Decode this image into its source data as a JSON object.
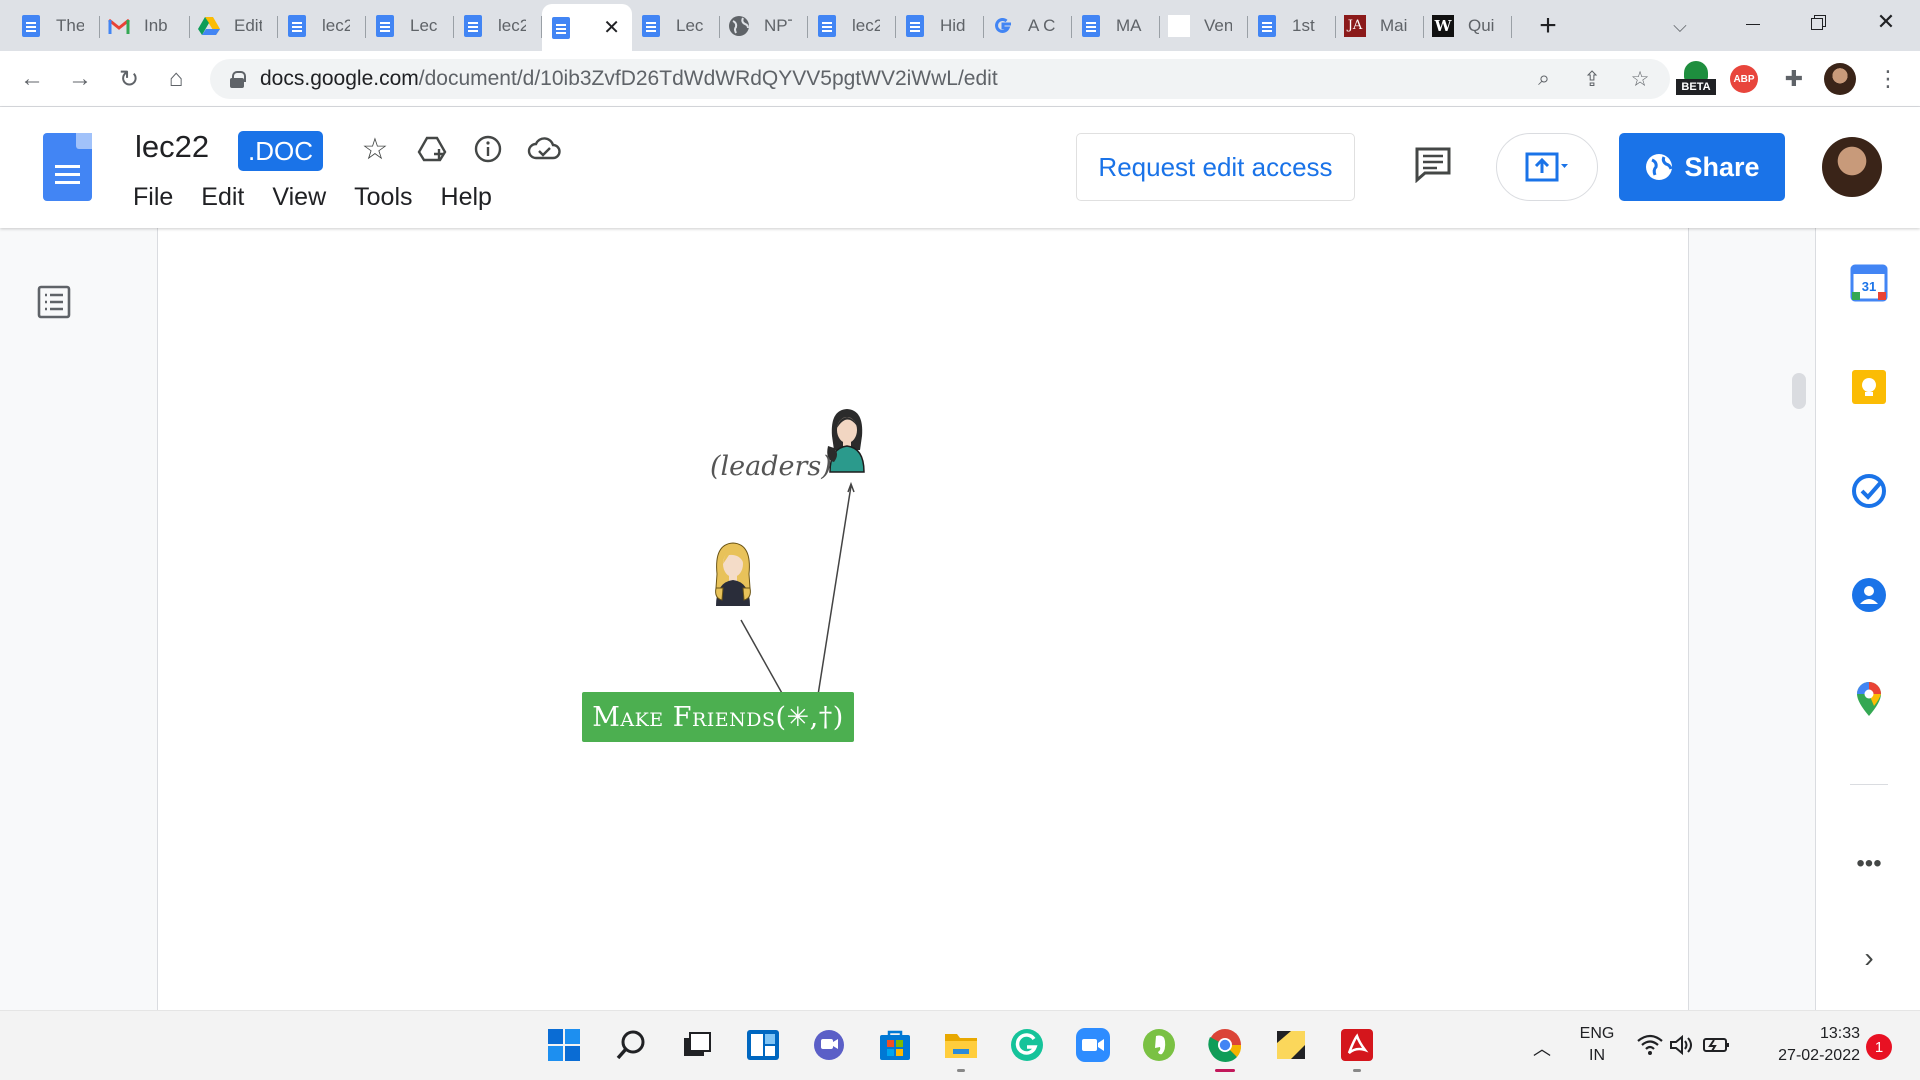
{
  "browser": {
    "tabs": [
      {
        "label": "The",
        "icon": "docs-icon"
      },
      {
        "label": "Inb",
        "icon": "gmail-icon"
      },
      {
        "label": "Edit",
        "icon": "drive-icon"
      },
      {
        "label": "lec2",
        "icon": "docs-icon"
      },
      {
        "label": "Lec",
        "icon": "docs-icon"
      },
      {
        "label": "lec2",
        "icon": "docs-icon"
      },
      {
        "label": "",
        "icon": "docs-icon",
        "active": true
      },
      {
        "label": "Lec",
        "icon": "docs-icon"
      },
      {
        "label": "NPT",
        "icon": "globe-icon"
      },
      {
        "label": "lec2",
        "icon": "docs-icon"
      },
      {
        "label": "Hid",
        "icon": "docs-icon"
      },
      {
        "label": "A C",
        "icon": "google-icon"
      },
      {
        "label": "MA",
        "icon": "docs-icon"
      },
      {
        "label": "Ven",
        "icon": "blank-icon"
      },
      {
        "label": "1st",
        "icon": "docs-icon"
      },
      {
        "label": "Mai",
        "icon": "ja-icon"
      },
      {
        "label": "Qui",
        "icon": "w-icon"
      }
    ],
    "url_host": "docs.google.com",
    "url_path": "/document/d/10ib3ZvfD26TdWdWRdQYVV5pgtWV2iWwL/edit",
    "beta_label": "BETA",
    "abp_label": "ABP"
  },
  "docs": {
    "title": "lec22",
    "ext_badge": ".DOC",
    "menu": [
      "File",
      "Edit",
      "View",
      "Tools",
      "Help"
    ],
    "request_edit_label": "Request edit access",
    "share_label": "Share"
  },
  "drawing": {
    "button_text": "Make Friends(✳,†)",
    "label_text": "(leaders)"
  },
  "taskbar": {
    "lang_line1": "ENG",
    "lang_line2": "IN",
    "time": "13:33",
    "date": "27-02-2022",
    "notification_count": "1"
  },
  "colors": {
    "docs_blue": "#1a73e8",
    "green_box": "#4caf50",
    "tab_strip": "#dee1e6"
  }
}
